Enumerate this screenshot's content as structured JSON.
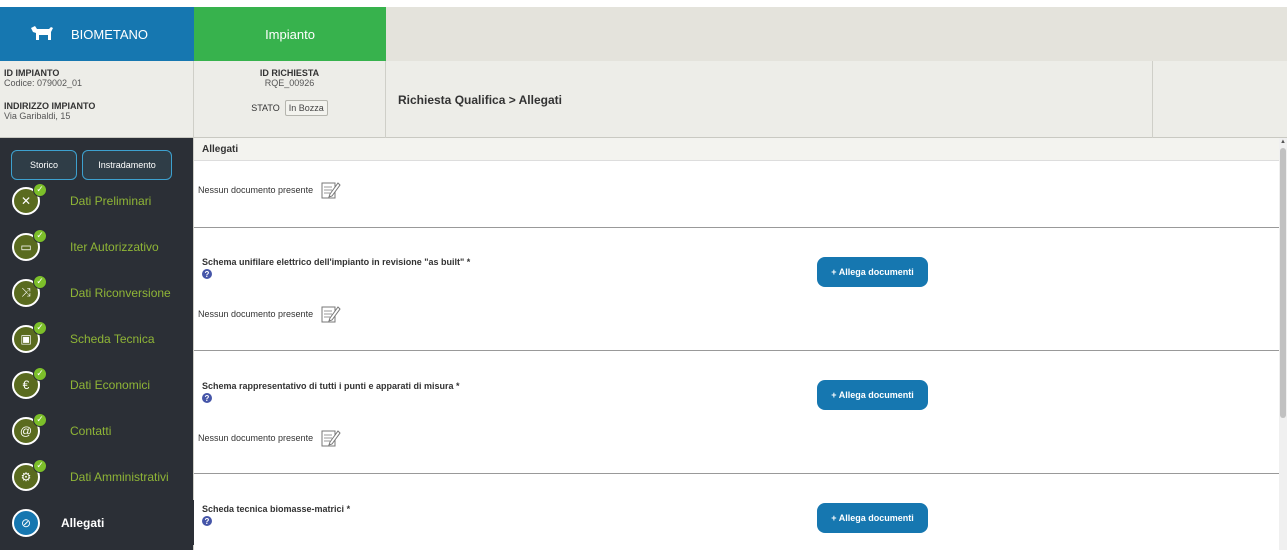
{
  "header": {
    "brand_label": "BIOMETANO",
    "tab_label": "Impianto",
    "brand_color": "#1677b0",
    "tab_color": "#37b24d"
  },
  "info": {
    "id_impianto_label": "ID IMPIANTO",
    "id_impianto_value": "Codice: 079002_01",
    "indirizzo_label": "INDIRIZZO IMPIANTO",
    "indirizzo_value": "Via Garibaldi, 15",
    "id_richiesta_label": "ID RICHIESTA",
    "id_richiesta_value": "RQE_00926",
    "stato_label": "STATO",
    "stato_value": "In Bozza",
    "breadcrumb": "Richiesta Qualifica > Allegati"
  },
  "sidebar": {
    "storico_label": "Storico",
    "instradamento_label": "Instradamento",
    "items": [
      {
        "label": "Dati Preliminari",
        "icon": "tools-icon"
      },
      {
        "label": "Iter Autorizzativo",
        "icon": "ticket-icon"
      },
      {
        "label": "Dati Riconversione",
        "icon": "shuffle-icon"
      },
      {
        "label": "Scheda Tecnica",
        "icon": "wallet-icon"
      },
      {
        "label": "Dati Economici",
        "icon": "euro-icon"
      },
      {
        "label": "Contatti",
        "icon": "contact-icon"
      },
      {
        "label": "Dati Amministrativi",
        "icon": "wrench-icon"
      },
      {
        "label": "Allegati",
        "icon": "paperclip-icon"
      }
    ]
  },
  "main": {
    "section_title": "Allegati",
    "no_doc_text": "Nessun documento presente",
    "attach_label": "+ Allega documenti",
    "help_glyph": "?",
    "sections": [
      {
        "title": "Schema unifilare elettrico dell'impianto in revisione \"as built\" *"
      },
      {
        "title": "Schema rappresentativo di tutti i punti e apparati di misura *"
      },
      {
        "title": "Scheda tecnica biomasse-matrici *"
      }
    ]
  }
}
